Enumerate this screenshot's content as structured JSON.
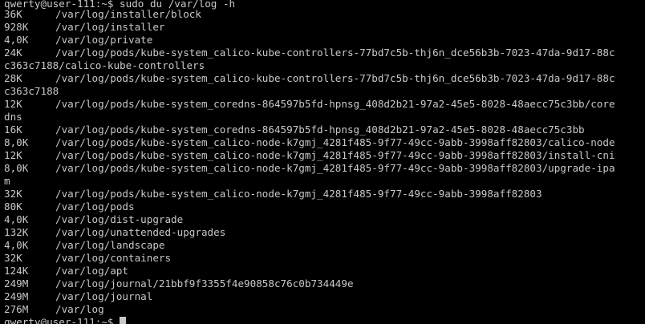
{
  "prompt": {
    "text": "qwerty@user-111:~$ sudo du /var/log -h"
  },
  "lines": [
    {
      "size": "36K",
      "path": "/var/log/installer/block"
    },
    {
      "size": "928K",
      "path": "/var/log/installer"
    },
    {
      "size": "4,0K",
      "path": "/var/log/private"
    },
    {
      "size": "24K",
      "path": "/var/log/pods/kube-system_calico-kube-controllers-77bd7c5b-thj6n_dce56b3b-7023-47da-9d17-88c"
    },
    {
      "size": "",
      "path": "c363c7188/calico-kube-controllers",
      "wrap": true
    },
    {
      "size": "28K",
      "path": "/var/log/pods/kube-system_calico-kube-controllers-77bd7c5b-thj6n_dce56b3b-7023-47da-9d17-88c"
    },
    {
      "size": "",
      "path": "c363c7188",
      "wrap": true
    },
    {
      "size": "12K",
      "path": "/var/log/pods/kube-system_coredns-864597b5fd-hpnsg_408d2b21-97a2-45e5-8028-48aecc75c3bb/core"
    },
    {
      "size": "",
      "path": "dns",
      "wrap": true
    },
    {
      "size": "16K",
      "path": "/var/log/pods/kube-system_coredns-864597b5fd-hpnsg_408d2b21-97a2-45e5-8028-48aecc75c3bb"
    },
    {
      "size": "8,0K",
      "path": "/var/log/pods/kube-system_calico-node-k7gmj_4281f485-9f77-49cc-9abb-3998aff82803/calico-node"
    },
    {
      "size": "12K",
      "path": "/var/log/pods/kube-system_calico-node-k7gmj_4281f485-9f77-49cc-9abb-3998aff82803/install-cni"
    },
    {
      "size": "8,0K",
      "path": "/var/log/pods/kube-system_calico-node-k7gmj_4281f485-9f77-49cc-9abb-3998aff82803/upgrade-ipa"
    },
    {
      "size": "",
      "path": "m",
      "wrap": true
    },
    {
      "size": "32K",
      "path": "/var/log/pods/kube-system_calico-node-k7gmj_4281f485-9f77-49cc-9abb-3998aff82803"
    },
    {
      "size": "80K",
      "path": "/var/log/pods"
    },
    {
      "size": "4,0K",
      "path": "/var/log/dist-upgrade"
    },
    {
      "size": "132K",
      "path": "/var/log/unattended-upgrades"
    },
    {
      "size": "4,0K",
      "path": "/var/log/landscape"
    },
    {
      "size": "32K",
      "path": "/var/log/containers"
    },
    {
      "size": "124K",
      "path": "/var/log/apt"
    },
    {
      "size": "249M",
      "path": "/var/log/journal/21bbf9f3355f4e90858c76c0b734449e"
    },
    {
      "size": "249M",
      "path": "/var/log/journal"
    },
    {
      "size": "276M",
      "path": "/var/log"
    }
  ],
  "trailing_prompt": {
    "text": "qwerty@user-111:~$ "
  },
  "colors": {
    "background": "#000000",
    "foreground": "#c8c8c8"
  }
}
